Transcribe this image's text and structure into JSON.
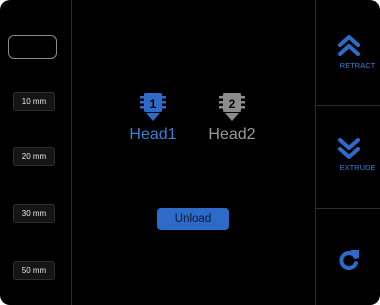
{
  "distance_input": {
    "value": ""
  },
  "steps": [
    {
      "label": "10 mm"
    },
    {
      "label": "20 mm"
    },
    {
      "label": "30 mm"
    },
    {
      "label": "50 mm"
    }
  ],
  "heads": [
    {
      "number": "1",
      "label": "Head1",
      "selected": true
    },
    {
      "number": "2",
      "label": "Head2",
      "selected": false
    }
  ],
  "actions": {
    "unload_label": "Unload",
    "retract_label": "RETRACT",
    "extrude_label": "EXTRUDE",
    "refresh_icon": "refresh-icon"
  },
  "colors": {
    "accent": "#2e6ac7",
    "accent_text": "#3b7fd4",
    "inactive": "#8c8c8c",
    "background": "#000000"
  }
}
